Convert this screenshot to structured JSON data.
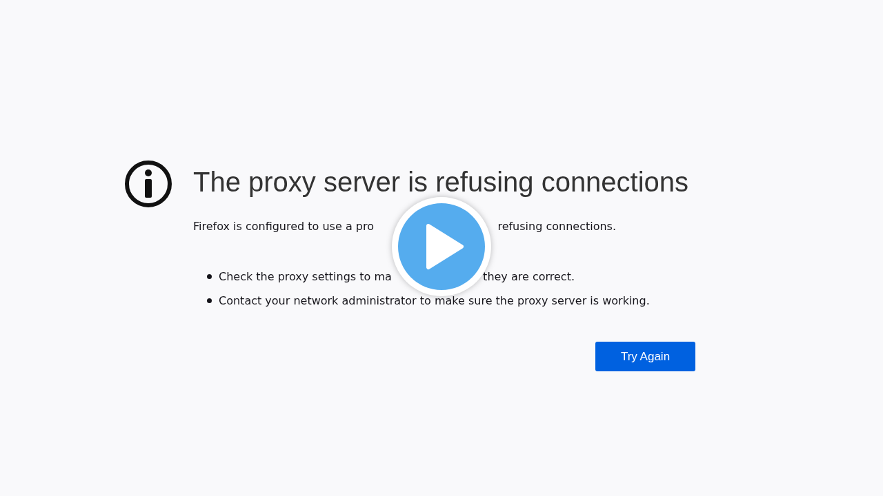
{
  "error_page": {
    "title": "The proxy server is refusing connections",
    "description": [
      "Firefox is configured to use a pro",
      "refusing connections."
    ],
    "suggestions": [
      [
        "Check the proxy settings to ma",
        "they are correct."
      ],
      [
        "Contact your network administrator to make sure the proxy server is working."
      ]
    ],
    "button": "Try Again"
  },
  "video_overlay": {
    "kind": "play_button"
  }
}
